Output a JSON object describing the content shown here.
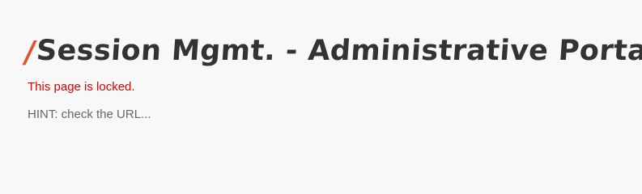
{
  "page": {
    "title_prefix": "/",
    "title": "Session Mgmt. - Administrative Portals",
    "title_suffix": "/",
    "locked_message": "This page is locked.",
    "hint": "HINT: check the URL..."
  },
  "colors": {
    "background": "#f8f8f8",
    "title": "#333333",
    "accent": "#e1532c",
    "error": "#e00000",
    "hint": "#666666"
  }
}
